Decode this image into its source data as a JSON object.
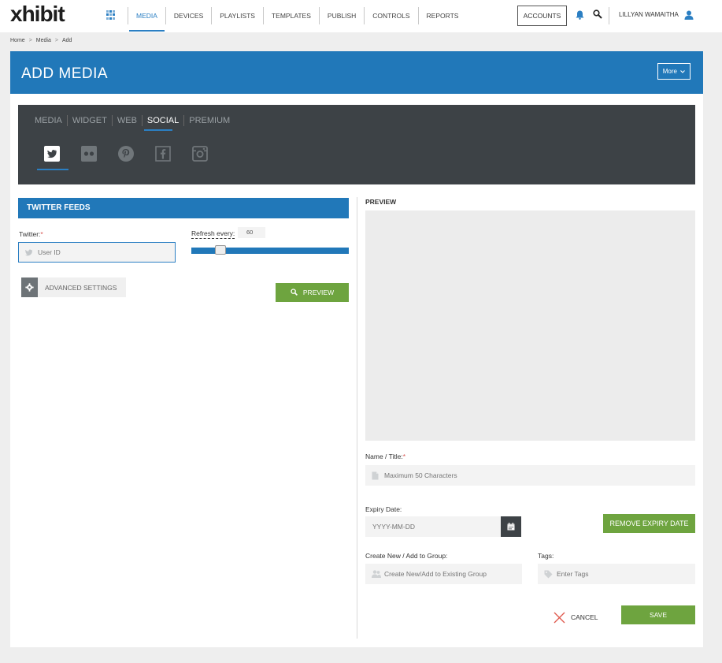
{
  "header": {
    "logo": "xhibit",
    "nav": [
      "MEDIA",
      "DEVICES",
      "PLAYLISTS",
      "TEMPLATES",
      "PUBLISH",
      "CONTROLS",
      "REPORTS"
    ],
    "accounts_label": "ACCOUNTS",
    "username": "LILLYAN WAMAITHA",
    "accent": "#2b7fc3"
  },
  "breadcrumb": [
    "Home",
    "Media",
    "Add"
  ],
  "banner": {
    "title": "ADD MEDIA",
    "more_label": "More"
  },
  "media_tabs": {
    "tabs": [
      "MEDIA",
      "WIDGET",
      "WEB",
      "SOCIAL",
      "PREMIUM"
    ],
    "active": "SOCIAL",
    "social_icons": [
      "twitter-icon",
      "flickr-icon",
      "pinterest-icon",
      "facebook-icon",
      "instagram-icon"
    ]
  },
  "twitter_feeds": {
    "heading": "TWITTER FEEDS",
    "twitter_label": "Twitter:",
    "required_mark": "*",
    "twitter_placeholder": "User ID",
    "refresh_label": "Refresh every:",
    "refresh_value": "60",
    "advanced_label": "ADVANCED SETTINGS",
    "preview_label": "PREVIEW"
  },
  "preview_panel": {
    "heading": "PREVIEW",
    "name_label": "Name / Title:",
    "name_placeholder": "Maximum 50 Characters",
    "expiry_label": "Expiry Date:",
    "expiry_placeholder": "YYYY-MM-DD",
    "remove_expiry_label": "REMOVE EXPIRY DATE",
    "group_label": "Create New / Add to Group:",
    "group_placeholder": "Create New/Add to Existing Group",
    "tags_label": "Tags:",
    "tags_placeholder": "Enter Tags",
    "cancel_label": "CANCEL",
    "save_label": "SAVE"
  },
  "colors": {
    "banner": "#2178b9",
    "tab_panel": "#3d4246",
    "green_button": "#6ea43f",
    "required": "#d9534f"
  }
}
